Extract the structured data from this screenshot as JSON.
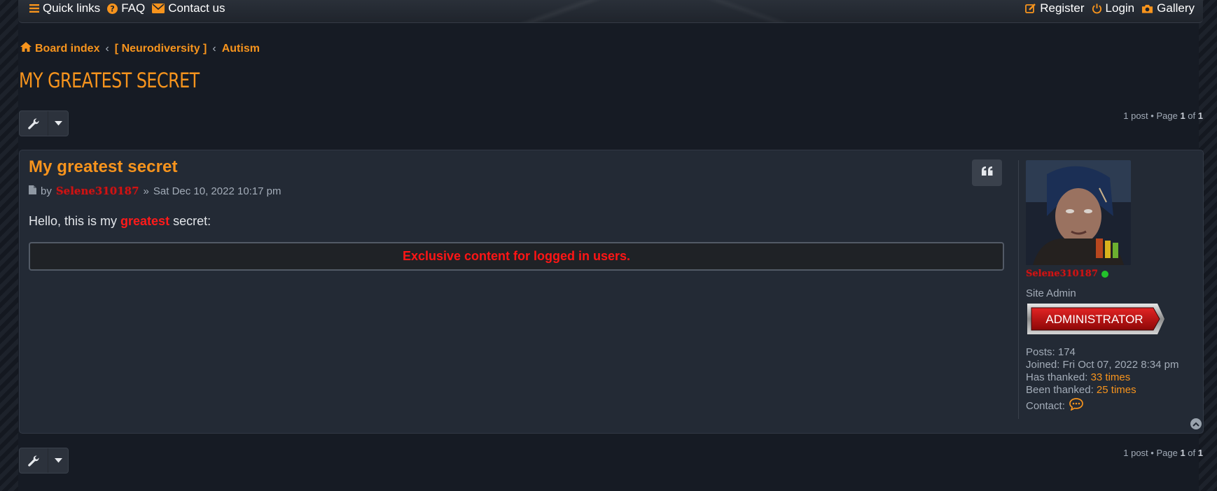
{
  "nav": {
    "left": [
      {
        "label": "Quick links",
        "icon": "bars-icon"
      },
      {
        "label": "FAQ",
        "icon": "question-circle-icon"
      },
      {
        "label": "Contact us",
        "icon": "envelope-icon"
      }
    ],
    "right": [
      {
        "label": "Register",
        "icon": "pencil-square-icon"
      },
      {
        "label": "Login",
        "icon": "power-icon"
      },
      {
        "label": "Gallery",
        "icon": "camera-icon"
      }
    ]
  },
  "breadcrumbs": {
    "items": [
      "Board index",
      "[ Neurodiversity ]",
      "Autism"
    ],
    "separator": "‹"
  },
  "page_title": "MY GREATEST SECRET",
  "pagination": {
    "prefix": "1 post • Page",
    "current": "1",
    "of_text": "of",
    "total": "1"
  },
  "post": {
    "title": "My greatest secret",
    "by_text": "by",
    "author": "Selene310187",
    "date_sep": "»",
    "date": "Sat Dec 10, 2022 10:17 pm",
    "body_before": "Hello, this is my ",
    "body_highlight": "greatest",
    "body_after": " secret:",
    "locked_message": "Exclusive content for logged in users."
  },
  "profile": {
    "username": "Selene310187",
    "rank_title": "Site Admin",
    "rank_badge": "ADMINISTRATOR",
    "posts_label": "Posts:",
    "posts_value": "174",
    "joined_label": "Joined:",
    "joined_value": "Fri Oct 07, 2022 8:34 pm",
    "thanked_label": "Has thanked:",
    "thanked_value": "33 times",
    "been_thanked_label": "Been thanked:",
    "been_thanked_value": "25 times",
    "contact_label": "Contact:"
  },
  "colors": {
    "accent": "#f7941d",
    "author": "#d21212",
    "locked_text": "#ff1515",
    "online": "#22c32b",
    "background": "#161b24",
    "post_bg": "#232a35"
  }
}
